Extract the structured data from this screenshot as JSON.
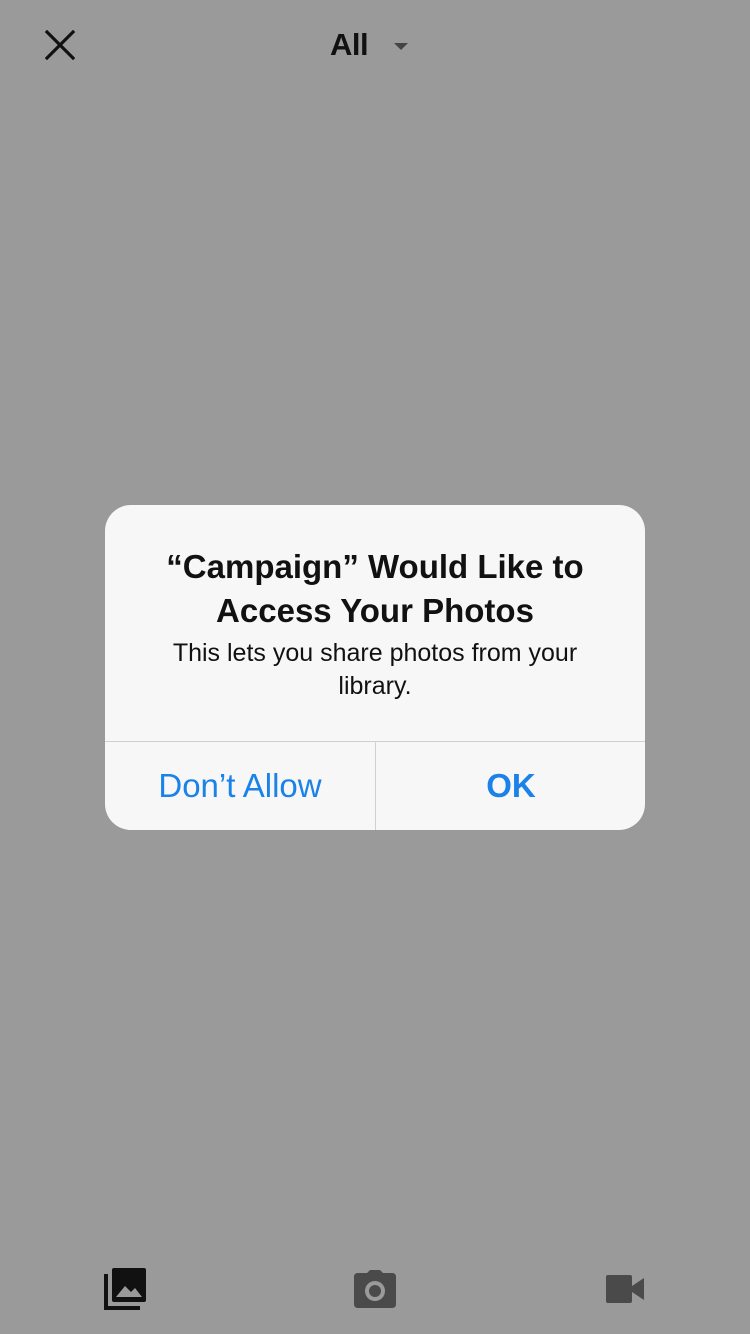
{
  "header": {
    "close_icon": "close-icon",
    "album_title": "All",
    "dropdown_icon": "caret-down-icon"
  },
  "alert": {
    "title": "“Campaign” Would Like to Access Your Photos",
    "message": "This lets you share photos from your library.",
    "deny_label": "Don’t Allow",
    "allow_label": "OK"
  },
  "bottom_tabs": [
    {
      "icon": "photo-library-icon"
    },
    {
      "icon": "camera-icon"
    },
    {
      "icon": "video-camera-icon"
    }
  ],
  "colors": {
    "background": "#9a9a9a",
    "alert_background": "#f7f7f7",
    "accent": "#1a82e8",
    "active_tab": "#111111",
    "inactive_tab": "#4a4a4a"
  }
}
